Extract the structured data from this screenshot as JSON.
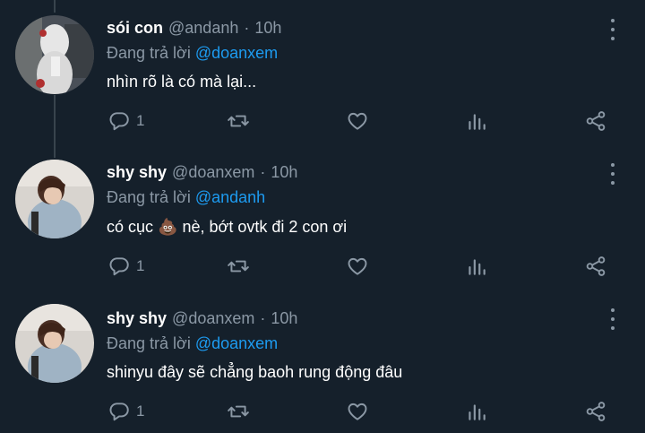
{
  "reply_prefix": "Đang trả lời",
  "tweets": [
    {
      "display_name": "sói con",
      "handle": "@andanh",
      "separator": "·",
      "time": "10h",
      "reply_to": "@doanxem",
      "text": "nhìn rõ là có mà lại...",
      "reply_count": "1",
      "avatar": "white-hooded-figure"
    },
    {
      "display_name": "shy shy",
      "handle": "@doanxem",
      "separator": "·",
      "time": "10h",
      "reply_to": "@andanh",
      "text_before": "có cục",
      "emoji": "💩",
      "text_after": "nè, bớt ovtk đi 2 con ơi",
      "reply_count": "1",
      "avatar": "person-denim-jacket"
    },
    {
      "display_name": "shy shy",
      "handle": "@doanxem",
      "separator": "·",
      "time": "10h",
      "reply_to": "@doanxem",
      "text": "shinyu đây sẽ chẳng baoh rung động đâu",
      "reply_count": "1",
      "avatar": "person-denim-jacket"
    }
  ],
  "icons": {
    "reply": "reply-icon",
    "retweet": "retweet-icon",
    "like": "like-icon",
    "views": "analytics-icon",
    "share": "share-icon",
    "more": "more-icon"
  },
  "colors": {
    "background": "#15202b",
    "text": "#ffffff",
    "secondary": "#8b98a5",
    "mention": "#1d9bf0"
  }
}
